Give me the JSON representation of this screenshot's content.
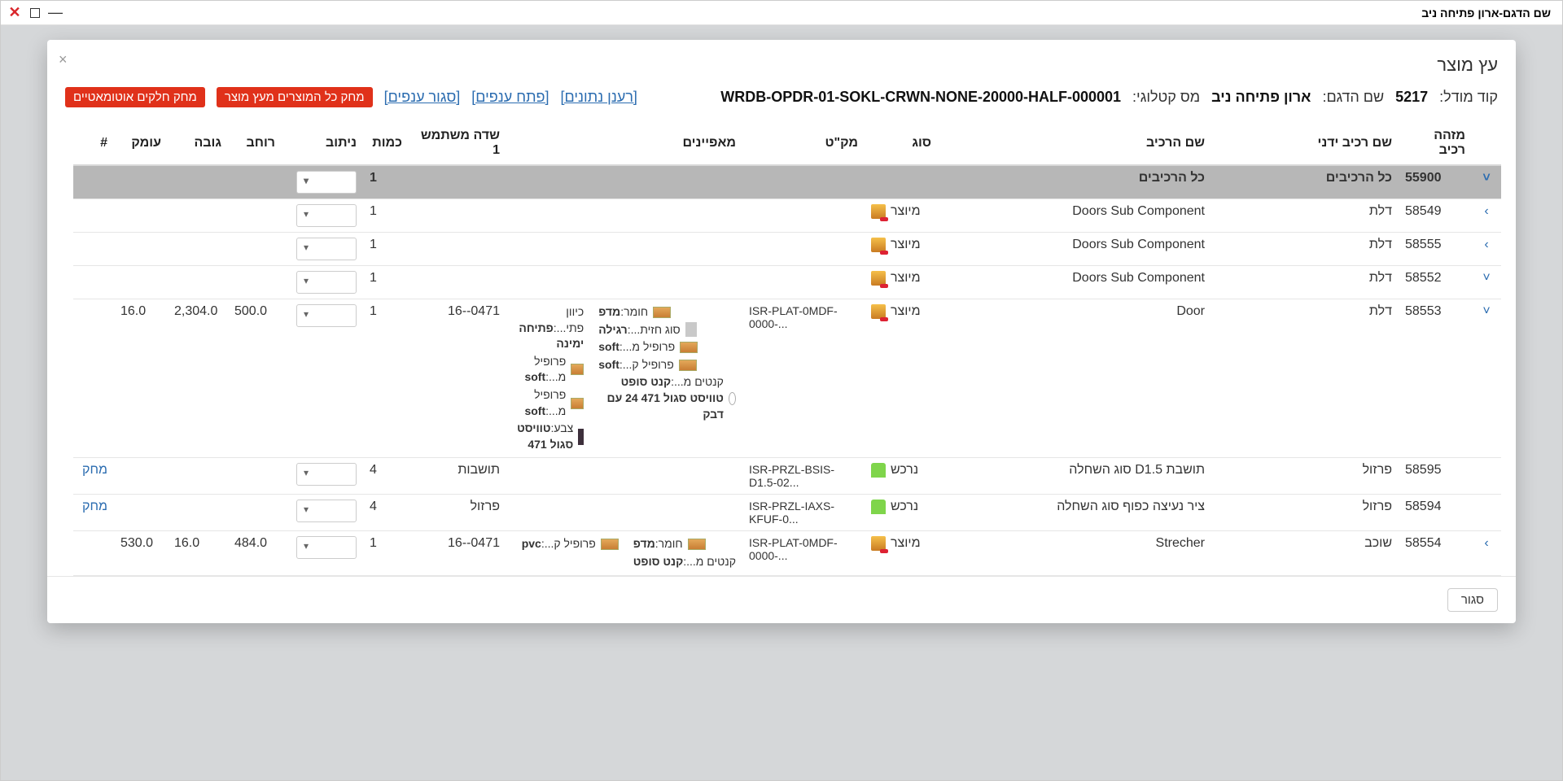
{
  "window": {
    "title": "שם הדגם-ארון פתיחה ניב"
  },
  "modal": {
    "title": "עץ מוצר",
    "close_btn": "סגור",
    "info": {
      "model_code_label": "קוד מודל:",
      "model_code": "5217",
      "model_name_label": "שם הדגם:",
      "model_name": "ארון פתיחה ניב",
      "catalog_label": "מס קטלוגי:",
      "catalog": "WRDB-OPDR-01-SOKL-CRWN-NONE-20000-HALF-000001"
    },
    "actions": {
      "refresh": "[רענן נתונים]",
      "open_branches": "[פתח ענפים]",
      "close_branches": "[סגור ענפים]",
      "delete_products": "מחק כל המוצרים מעץ מוצר",
      "delete_auto_parts": "מחק חלקים אוטומאטיים"
    }
  },
  "table": {
    "headers": {
      "id": "מזהה רכיב",
      "manual_name": "שם רכיב ידני",
      "name": "שם הרכיב",
      "type": "סוג",
      "sku": "מק\"ט",
      "attrs": "מאפיינים",
      "user1": "שדה משתמש 1",
      "qty": "כמות",
      "route": "ניתוב",
      "width": "רוחב",
      "height": "גובה",
      "depth": "עומק",
      "hash": "#"
    },
    "rows": [
      {
        "id": "55900",
        "manual": "כל הרכיבים",
        "name": "כל הרכיבים",
        "type": "",
        "typeKind": "",
        "sku": "",
        "qty": "1",
        "expander": "˅",
        "root": true
      },
      {
        "id": "58549",
        "manual": "דלת",
        "name": "Doors Sub Component",
        "type": "מיוצר",
        "typeKind": "mfg",
        "sku": "",
        "qty": "1",
        "expander": "‹"
      },
      {
        "id": "58555",
        "manual": "דלת",
        "name": "Doors Sub Component",
        "type": "מיוצר",
        "typeKind": "mfg",
        "sku": "",
        "qty": "1",
        "expander": "‹"
      },
      {
        "id": "58552",
        "manual": "דלת",
        "name": "Doors Sub Component",
        "type": "מיוצר",
        "typeKind": "mfg",
        "sku": "",
        "qty": "1",
        "expander": "˅"
      },
      {
        "id": "58553",
        "manual": "דלת",
        "name": "Door",
        "type": "מיוצר",
        "typeKind": "mfg",
        "sku": "ISR-PLAT-0MDF-0000-...",
        "qty": "1",
        "user1": "16--0471",
        "width": "500.0",
        "height": "2,304.0",
        "depth": "16.0",
        "expander": "˅",
        "attrs_right": [
          {
            "k": "חומר:",
            "v": "מדפ",
            "sw": "wood"
          },
          {
            "k": "סוג חזית...:",
            "v": "רגילה",
            "sw": "grey"
          },
          {
            "k": "פרופיל מ...:",
            "v": "soft",
            "sw": "wood"
          },
          {
            "k": "פרופיל ק...:",
            "v": "soft",
            "sw": "wood"
          },
          {
            "k": "קנטים מ...:",
            "v": "קנט סופט טוויסט סגול 471 24 עם דבק",
            "sw": "circle"
          }
        ],
        "attrs_left": [
          {
            "k": "כיוון פתי...:",
            "v": "פתיחה ימינה"
          },
          {
            "k": "פרופיל מ...:",
            "v": "soft",
            "sw": "wood"
          },
          {
            "k": "פרופיל מ...:",
            "v": "soft",
            "sw": "wood"
          },
          {
            "k": "צבע:",
            "v": "טוויסט סגול 471",
            "sw": "dark"
          }
        ]
      },
      {
        "id": "58595",
        "manual": "פרזול",
        "name": "תושבת D1.5 סוג השחלה",
        "type": "נרכש",
        "typeKind": "buy",
        "sku": "ISR-PRZL-BSIS-D1.5-02...",
        "qty": "4",
        "user1": "תושבות",
        "hash_link": "מחק"
      },
      {
        "id": "58594",
        "manual": "פרזול",
        "name": "ציר נעיצה כפוף סוג השחלה",
        "type": "נרכש",
        "typeKind": "buy",
        "sku": "ISR-PRZL-IAXS-KFUF-0...",
        "qty": "4",
        "user1": "פרזול",
        "hash_link": "מחק"
      },
      {
        "id": "58554",
        "manual": "שוכב",
        "name": "Strecher",
        "type": "מיוצר",
        "typeKind": "mfg",
        "sku": "ISR-PLAT-0MDF-0000-...",
        "qty": "1",
        "user1": "16--0471",
        "width": "484.0",
        "height": "16.0",
        "depth": "530.0",
        "expander": "‹",
        "attrs_right": [
          {
            "k": "חומר:",
            "v": "מדפ",
            "sw": "wood"
          },
          {
            "k": "קנטים מ...:",
            "v": "קנט סופט",
            "sw": ""
          }
        ],
        "attrs_left": [
          {
            "k": "פרופיל ק...:",
            "v": "pvc",
            "sw": "wood"
          }
        ]
      }
    ]
  }
}
